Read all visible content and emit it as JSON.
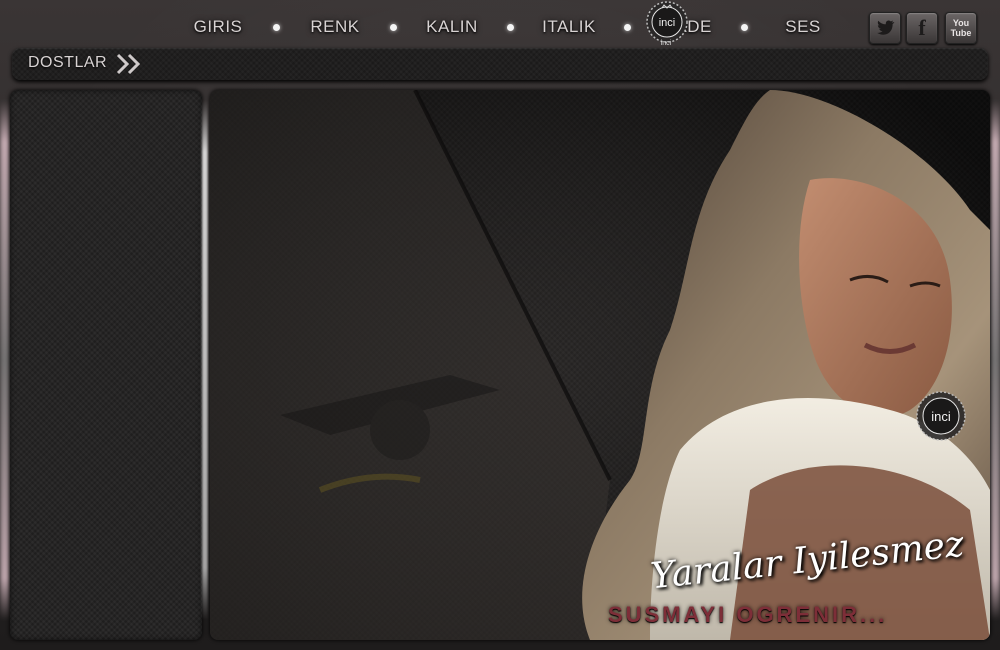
{
  "nav": {
    "items": [
      {
        "label": "GIRIS"
      },
      {
        "label": "RENK"
      },
      {
        "label": "KALIN"
      },
      {
        "label": "ITALIK"
      },
      {
        "label": "IFADE"
      },
      {
        "label": "SES"
      }
    ]
  },
  "logo": {
    "text": "inci",
    "caption": "inci"
  },
  "social": {
    "twitter_icon": "twitter-bird-icon",
    "facebook_label": "f",
    "youtube_label": "You Tube"
  },
  "bar": {
    "label": "DOSTLAR"
  },
  "banner": {
    "line1": "Yaralar Iyilesmez",
    "line2": "SUSMAYI OGRENIR..."
  },
  "colors": {
    "background": "#2e2b2b",
    "panel": "#1c1b1b",
    "nav_text": "#d8d3d3",
    "tagline_accent": "#7d2e38"
  }
}
